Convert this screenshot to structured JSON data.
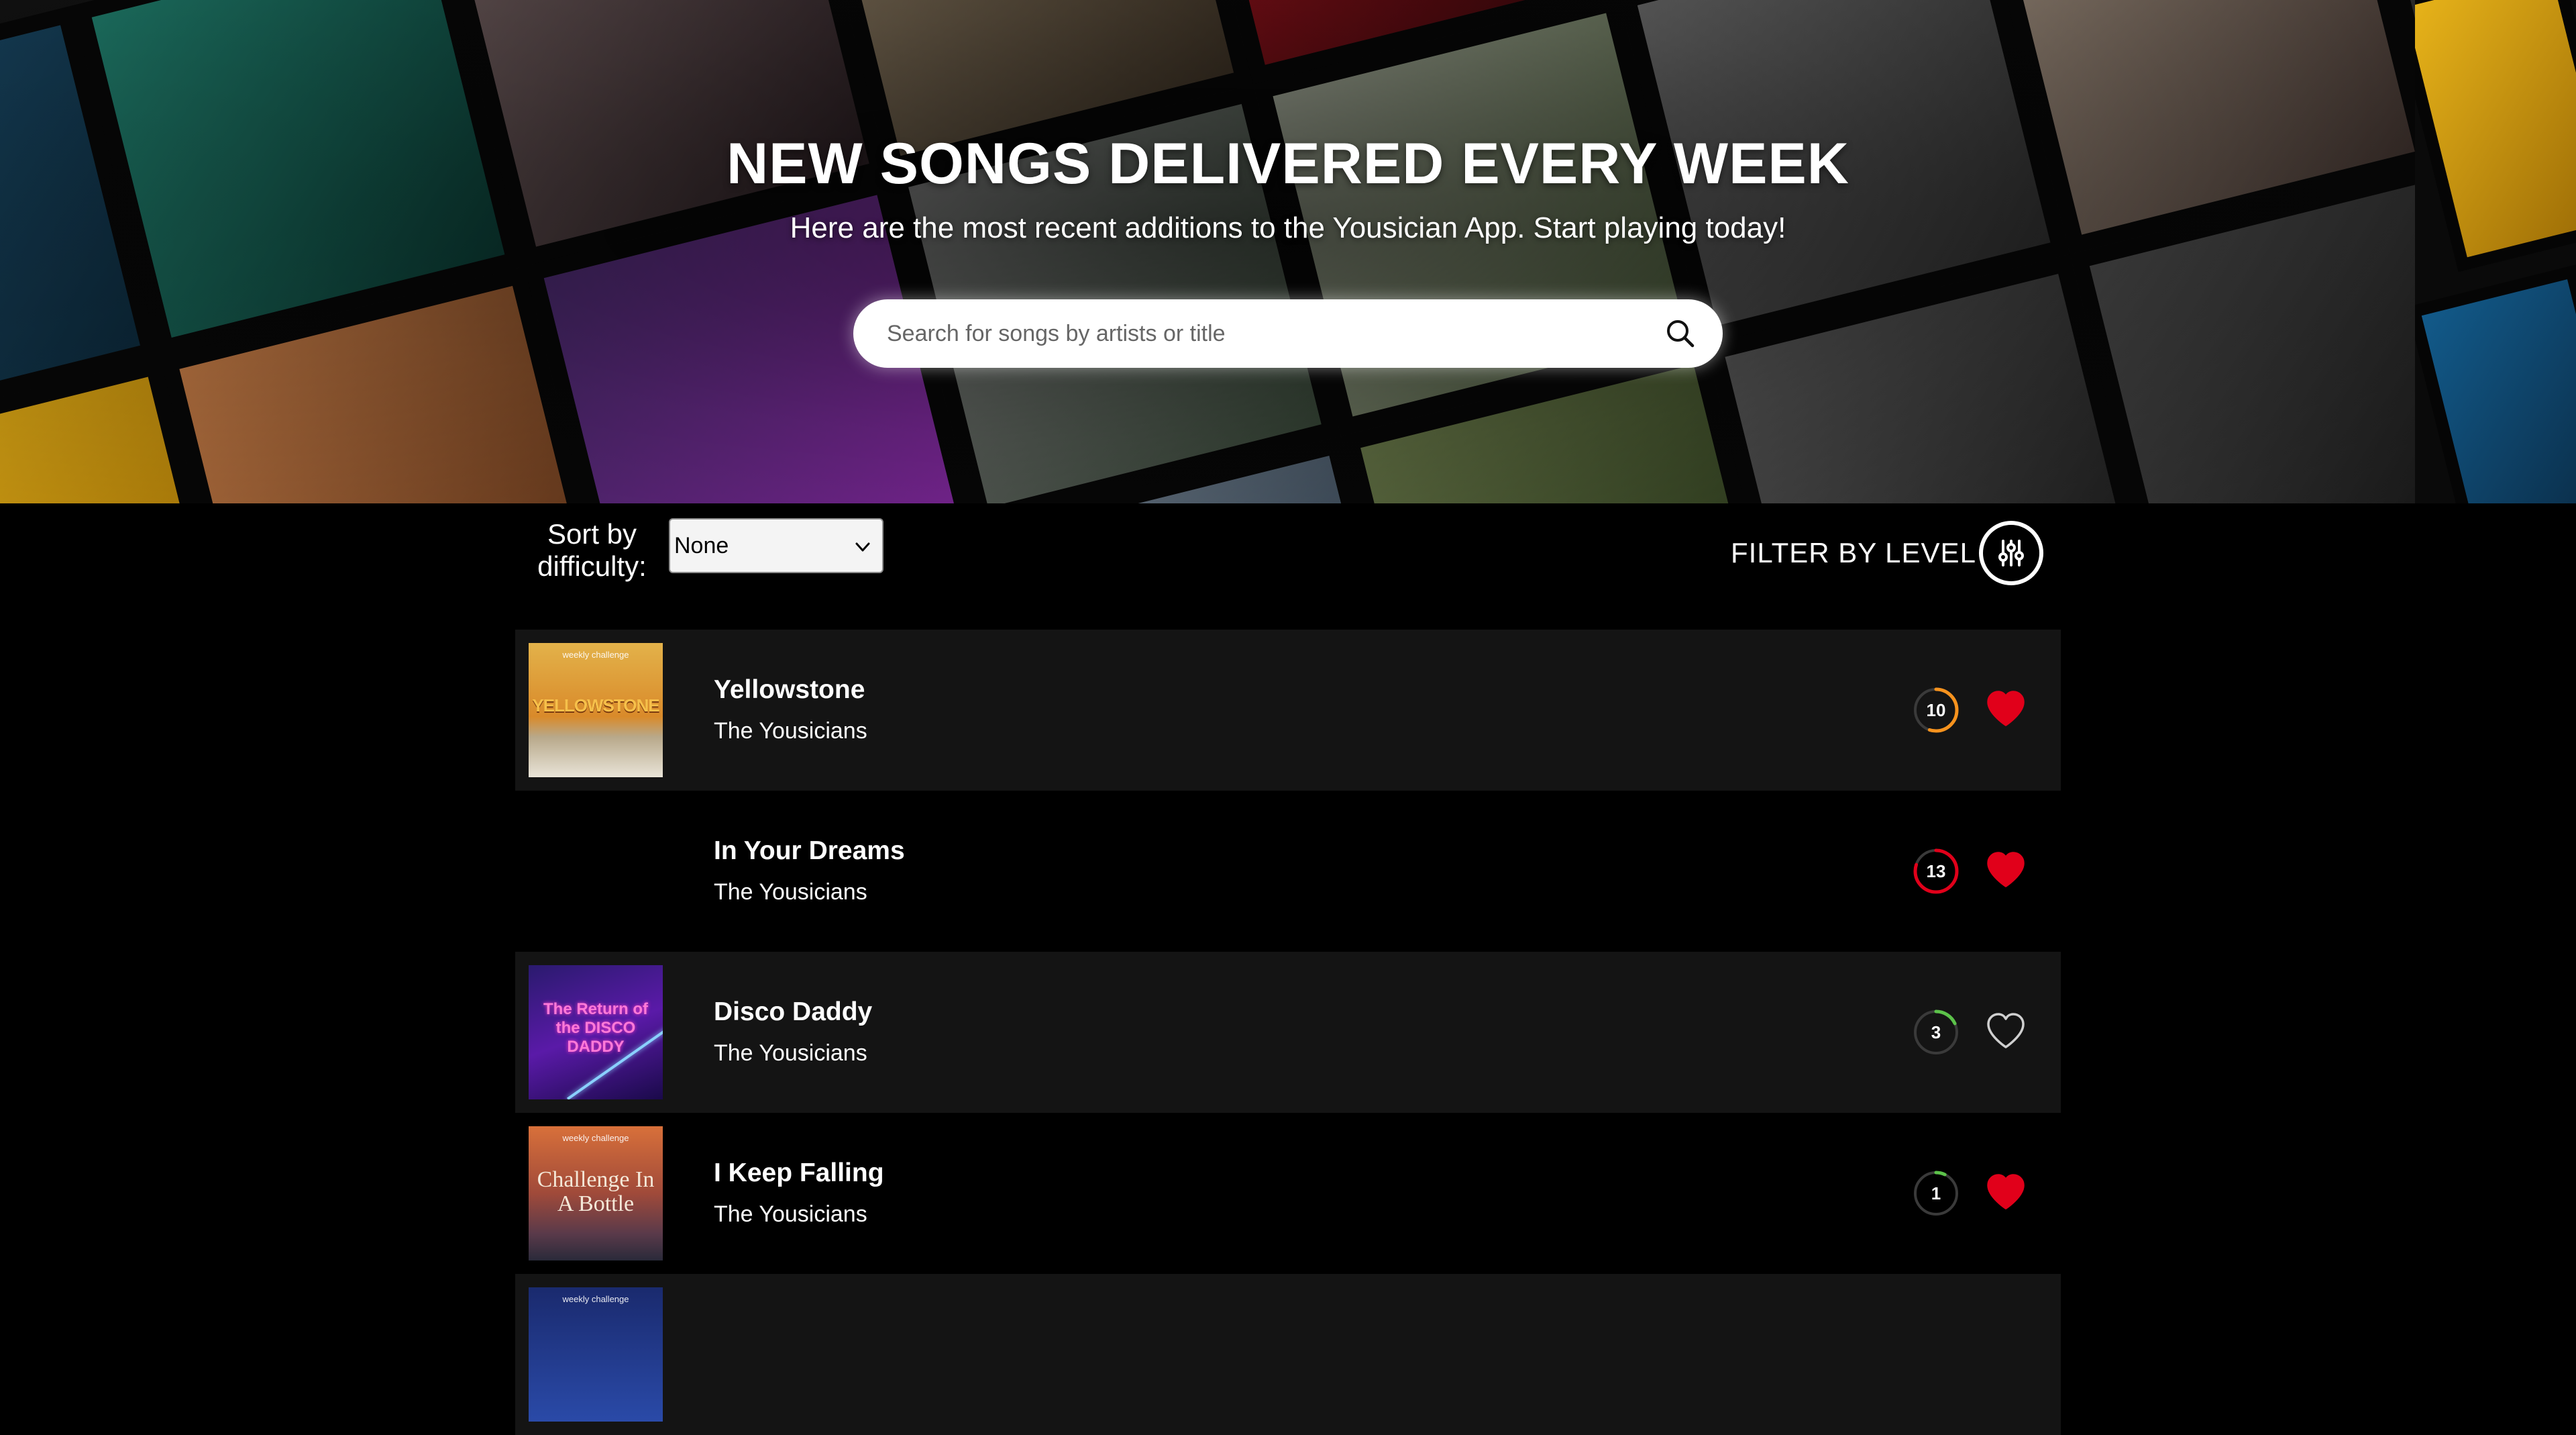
{
  "hero": {
    "title": "NEW SONGS DELIVERED EVERY WEEK",
    "subtitle": "Here are the most recent additions to the Yousician App. Start playing today!"
  },
  "search": {
    "placeholder": "Search for songs by artists or title",
    "icon": "search-icon"
  },
  "sort": {
    "label": "Sort by difficulty:",
    "selected": "None"
  },
  "filter": {
    "label": "FILTER BY LEVEL",
    "icon": "sliders-icon"
  },
  "colors": {
    "background": "#000000",
    "row_shade": "#141414",
    "heart_active": "#e1001a",
    "level_orange": "#f7931e",
    "level_red": "#e1001a",
    "level_green": "#5cc24a"
  },
  "songs": [
    {
      "title": "Yellowstone",
      "artist": "The Yousicians",
      "level": "10",
      "level_color": "#f7931e",
      "level_progress": 0.55,
      "favorite": true,
      "cover_tag": "weekly challenge",
      "cover_text": "YELLOWSTONE"
    },
    {
      "title": "In Your Dreams",
      "artist": "The Yousicians",
      "level": "13",
      "level_color": "#e1001a",
      "level_progress": 0.8,
      "favorite": true,
      "cover_tag": "",
      "cover_text": ""
    },
    {
      "title": "Disco Daddy",
      "artist": "The Yousicians",
      "level": "3",
      "level_color": "#5cc24a",
      "level_progress": 0.18,
      "favorite": false,
      "cover_tag": "",
      "cover_text": "The Return of the DISCO DADDY"
    },
    {
      "title": "I Keep Falling",
      "artist": "The Yousicians",
      "level": "1",
      "level_color": "#5cc24a",
      "level_progress": 0.07,
      "favorite": true,
      "cover_tag": "weekly challenge",
      "cover_text": "Challenge In A Bottle"
    },
    {
      "title": "",
      "artist": "",
      "level": "",
      "level_color": "#5cc24a",
      "level_progress": 0,
      "favorite": false,
      "cover_tag": "weekly challenge",
      "cover_text": ""
    }
  ]
}
